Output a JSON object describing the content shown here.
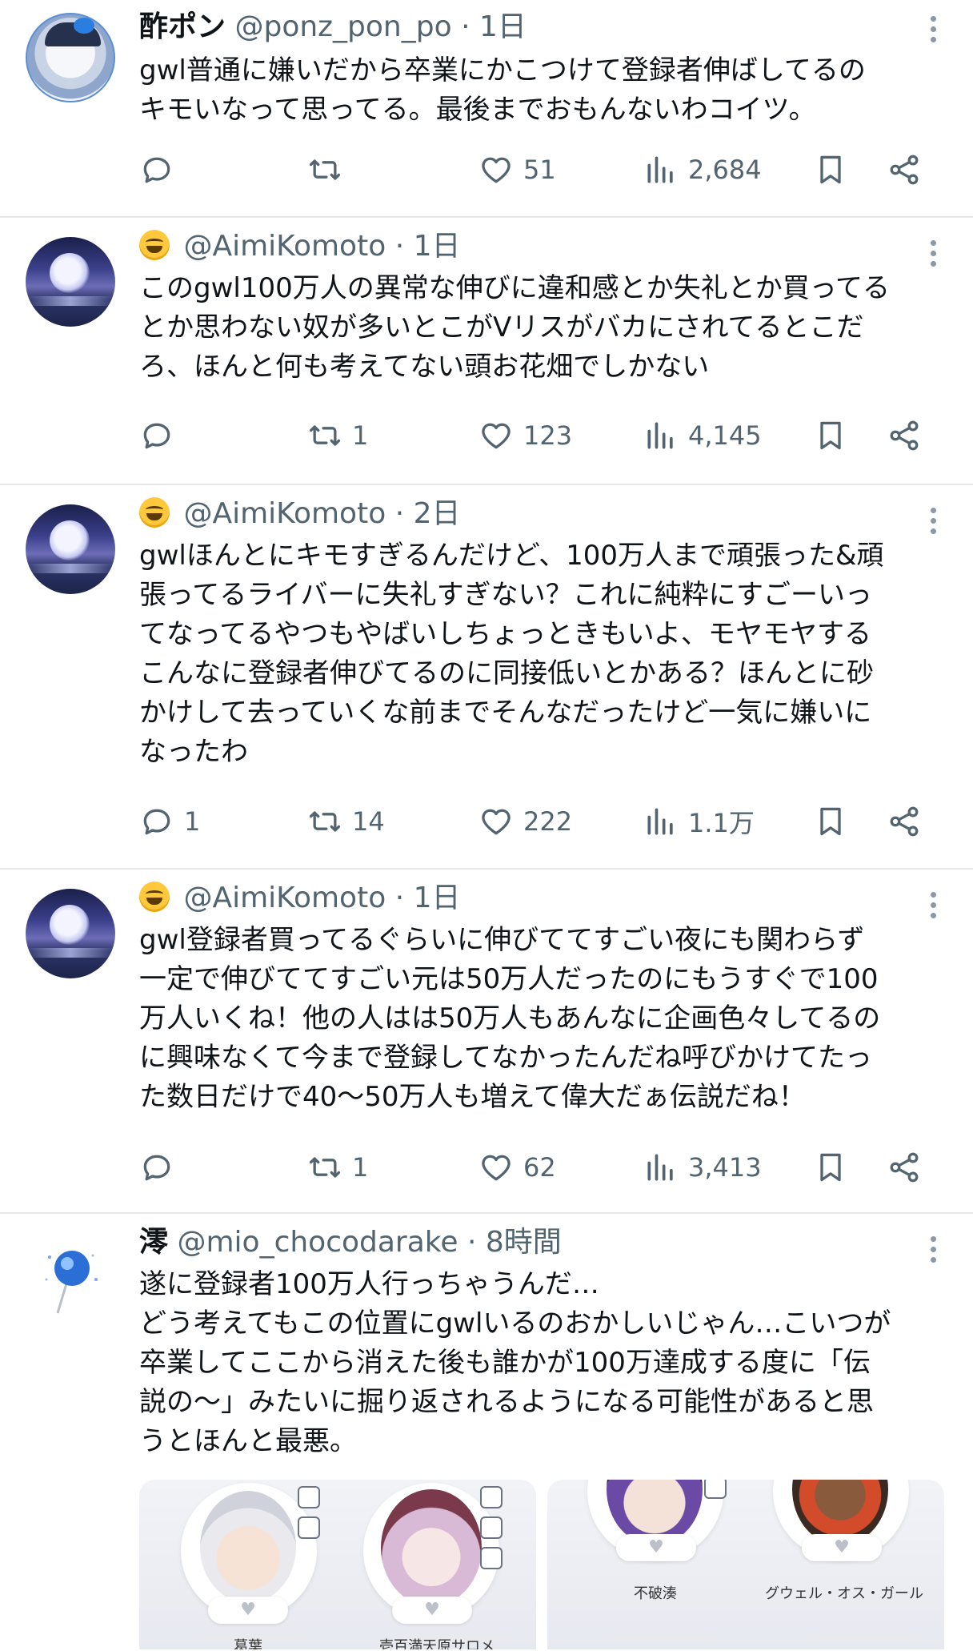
{
  "tweets": [
    {
      "name": "酢ポン",
      "handle": "@ponz_pon_po",
      "dot": "·",
      "time": "1日",
      "body": "gwl普通に嫌いだから卒業にかこつけて登録者伸ばしてるの\nキモいなって思ってる。最後までおもんないわコイツ。",
      "replies": "",
      "retweets": "",
      "likes": "51",
      "views": "2,684"
    },
    {
      "name": "",
      "handle": "@AimiKomoto",
      "dot": "·",
      "time": "1日",
      "body": "このgwl100万人の異常な伸びに違和感とか失礼とか買ってる\nとか思わない奴が多いとこがVリスがバカにされてるとこだ\nろ、ほんと何も考えてない頭お花畑でしかない",
      "replies": "",
      "retweets": "1",
      "likes": "123",
      "views": "4,145"
    },
    {
      "name": "",
      "handle": "@AimiKomoto",
      "dot": "·",
      "time": "2日",
      "body": "gwlほんとにキモすぎるんだけど、100万人まで頑張った&頑\n張ってるライバーに失礼すぎない？これに純粋にすごーいっ\nてなってるやつもやばいしちょっときもいよ、モヤモヤする\nこんなに登録者伸びてるのに同接低いとかある？ほんとに砂\nかけして去っていくな前までそんなだったけど一気に嫌いに\nなったわ",
      "replies": "1",
      "retweets": "14",
      "likes": "222",
      "views": "1.1万"
    },
    {
      "name": "",
      "handle": "@AimiKomoto",
      "dot": "·",
      "time": "1日",
      "body": "gwl登録者買ってるぐらいに伸びててすごい夜にも関わらず\n一定で伸びててすごい元は50万人だったのにもうすぐで100\n万人いくね！他の人はは50万人もあんなに企画色々してるの\nに興味なくて今まで登録してなかったんだね呼びかけてたっ\nた数日だけで40〜50万人も増えて偉大だぁ伝説だね！",
      "replies": "",
      "retweets": "1",
      "likes": "62",
      "views": "3,413"
    },
    {
      "name": "澪",
      "handle": "@mio_chocodarake",
      "dot": "·",
      "time": "8時間",
      "body": "遂に登録者100万人行っちゃうんだ…\nどう考えてもこの位置にgwlいるのおかしいじゃん…こいつが\n卒業してここから消えた後も誰かが100万達成する度に「伝\n説の〜」みたいに掘り返されるようになる可能性があると思\nうとほんと最悪。"
    }
  ],
  "media": {
    "left_labels": [
      "葛葉",
      "壱百満天原サロメ"
    ],
    "right_labels": [
      "不破湊",
      "グウェル・オス・ガール"
    ]
  },
  "icons": {
    "reply": "reply-icon",
    "retweet": "retweet-icon",
    "like": "heart-icon",
    "views": "views-icon",
    "bookmark": "bookmark-icon",
    "share": "share-icon",
    "more": "more-icon",
    "emoji": "grinning-face-emoji"
  },
  "colors": {
    "text": "#0f1419",
    "muted": "#536471",
    "divider": "#e6e9ec"
  }
}
